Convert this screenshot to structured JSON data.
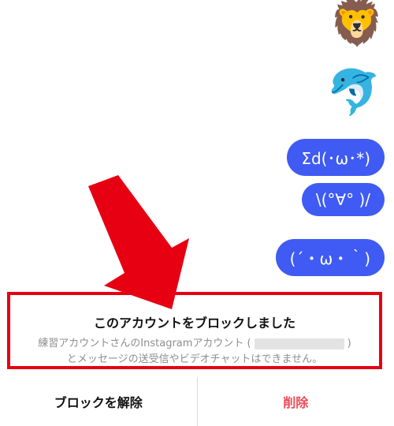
{
  "messages": [
    {
      "kind": "emoji",
      "content": "🦁"
    },
    {
      "kind": "emoji",
      "content": "🐬"
    },
    {
      "kind": "text",
      "content": "Σd(･ω･*)"
    },
    {
      "kind": "text",
      "content": "\\(°∀° )/"
    },
    {
      "kind": "text",
      "content": "(´・ω・｀)"
    }
  ],
  "banner": {
    "title": "このアカウントをブロックしました",
    "desc_before": "練習アカウントさんのInstagramアカウント (",
    "desc_after": ")",
    "desc_line2": "とメッセージの送受信やビデオチャットはできません。"
  },
  "actions": {
    "unblock_label": "ブロックを解除",
    "delete_label": "削除"
  },
  "colors": {
    "bubble": "#3f5bf3",
    "annotation": "#e60012",
    "delete": "#ed4956"
  }
}
